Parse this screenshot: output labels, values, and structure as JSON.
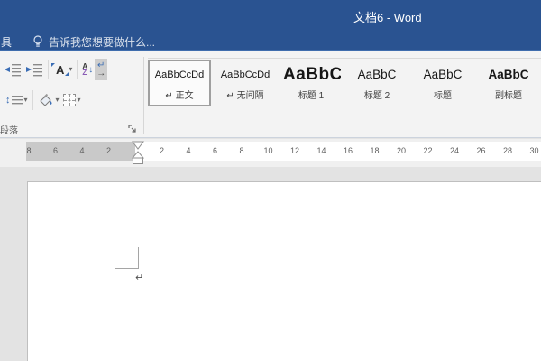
{
  "window": {
    "title": "文档6 - Word"
  },
  "tab_row": {
    "partial_tab_label": "具",
    "tell_me_label": "告诉我您想要做什么..."
  },
  "ribbon": {
    "paragraph_group": {
      "label": "段落",
      "icons": {
        "row1": [
          "decrease-indent-icon",
          "increase-indent-icon",
          "asian-layout-icon",
          "sort-icon",
          "show-hide-marks-icon"
        ],
        "row2": [
          "line-spacing-icon",
          "shading-icon",
          "borders-icon"
        ]
      },
      "glyphs": {
        "asian_a": "A",
        "sort_a": "A",
        "sort_z": "Z",
        "sort_arrow": "↓",
        "show_hide_enter": "↵",
        "show_hide_arrow": "→",
        "line_spacing_arrow": "↕",
        "caret": "▾"
      }
    },
    "style_gallery": {
      "items": [
        {
          "preview": "AaBbCcDd",
          "label": "↵ 正文",
          "selected": true
        },
        {
          "preview": "AaBbCcDd",
          "label": "↵ 无间隔",
          "selected": false
        },
        {
          "preview": "AaBbCc",
          "label": "标题 1",
          "selected": false
        },
        {
          "preview": "AaBbC",
          "label": "标题 2",
          "selected": false
        },
        {
          "preview": "AaBbC",
          "label": "标题",
          "selected": false
        },
        {
          "preview": "AaBbC",
          "label": "副标题",
          "selected": false
        }
      ]
    }
  },
  "ruler": {
    "left_numbers": [
      "8",
      "6",
      "4",
      "2"
    ],
    "right_numbers": [
      "2",
      "4",
      "6",
      "8",
      "10",
      "12",
      "14",
      "16",
      "18",
      "20",
      "22",
      "24",
      "26",
      "28",
      "30"
    ]
  },
  "document": {
    "paragraph_mark": "↵"
  },
  "colors": {
    "titlebar_blue": "#2a5391",
    "tab_underline_blue": "#3f6dad",
    "ribbon_bg": "#f3f3f3",
    "ruler_margin_gray": "#c9c9c9",
    "document_bg": "#e3e3e3",
    "accent_blue": "#3a6db5",
    "pressed_button_bg": "#cdcdcd"
  }
}
